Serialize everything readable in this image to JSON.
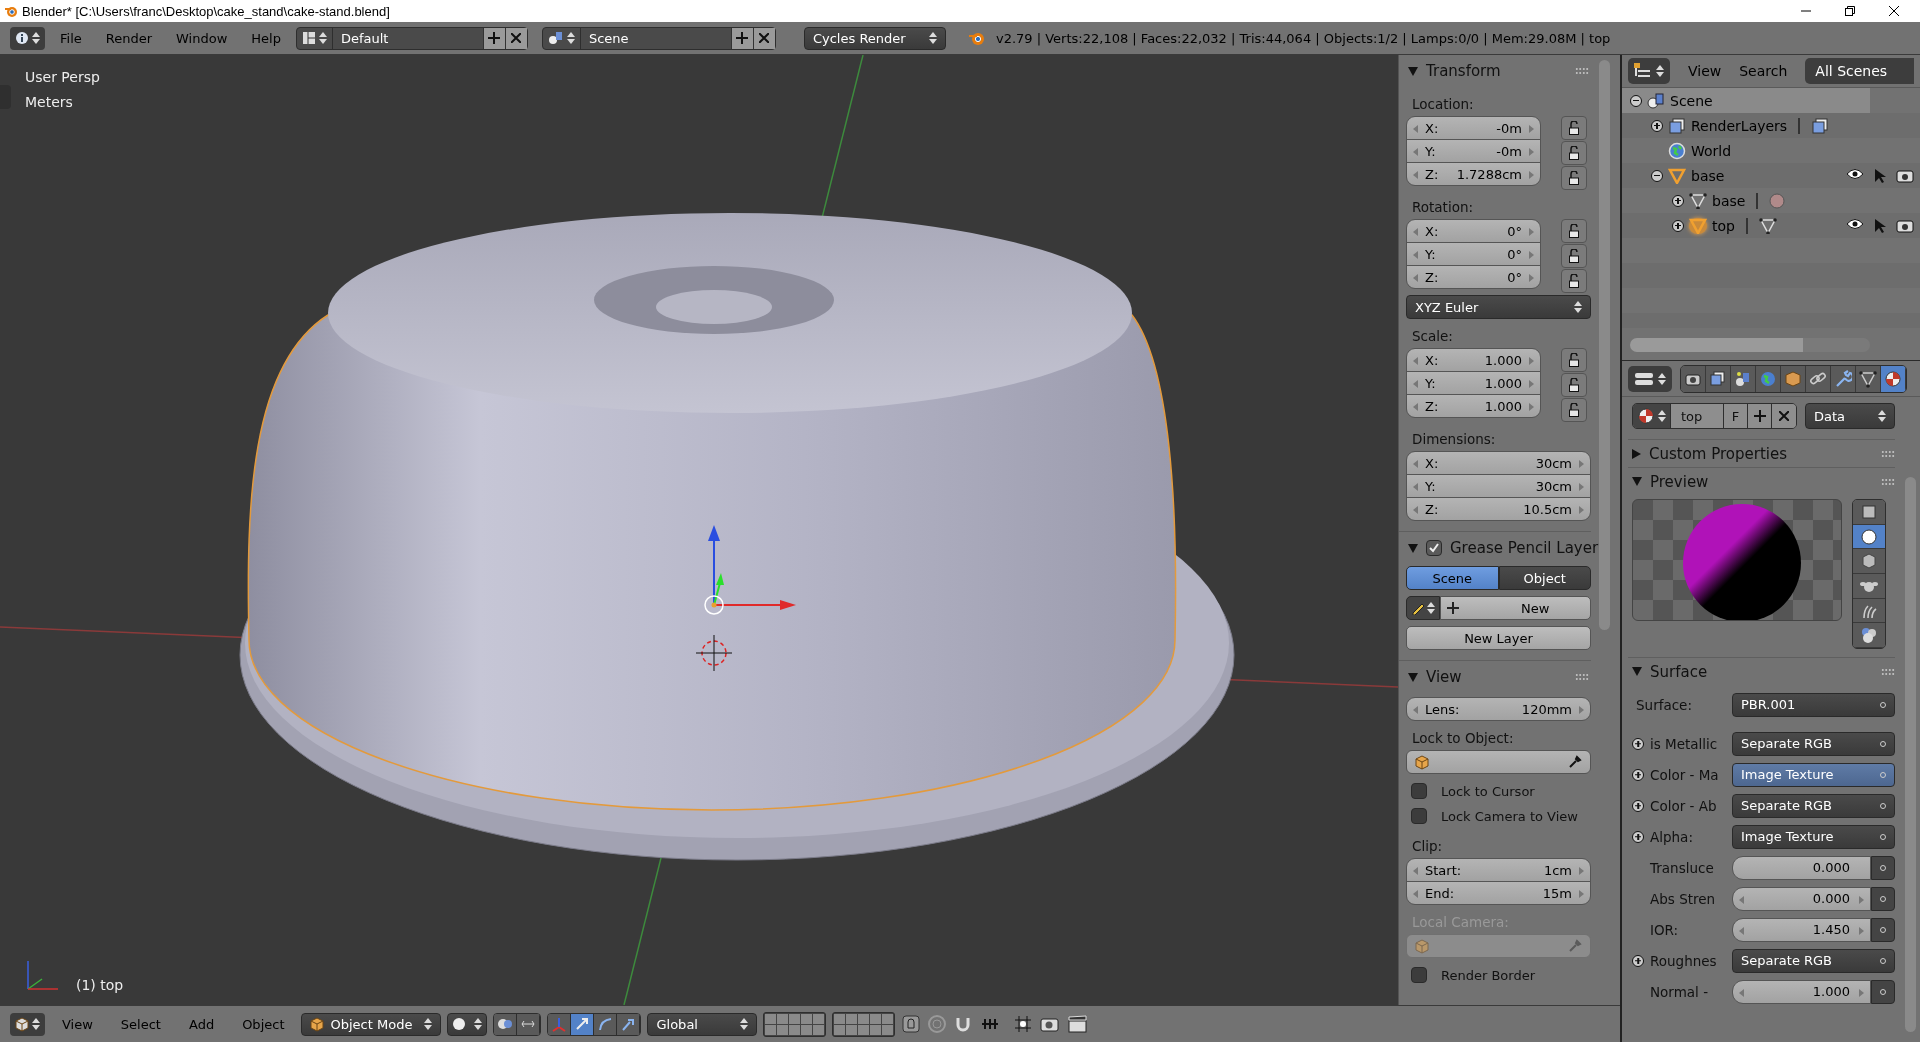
{
  "window": {
    "title": "Blender* [C:\\Users\\franc\\Desktop\\cake_stand\\cake-stand.blend]"
  },
  "info_header": {
    "menus": [
      "File",
      "Render",
      "Window",
      "Help"
    ],
    "layout": "Default",
    "scene": "Scene",
    "engine": "Cycles Render",
    "stats": "v2.79 | Verts:22,108 | Faces:22,032 | Tris:44,064 | Objects:1/2 | Lamps:0/0 | Mem:29.08M | top"
  },
  "viewport": {
    "view_name": "User Persp",
    "units": "Meters",
    "object_label": "(1) top"
  },
  "view_header": {
    "menus": [
      "View",
      "Select",
      "Add",
      "Object"
    ],
    "mode": "Object Mode",
    "orientation": "Global"
  },
  "transform_panel": {
    "title": "Transform",
    "expanded": true,
    "groups": [
      {
        "label": "Location:",
        "fields": [
          {
            "axis": "X:",
            "value": "-0m",
            "locked": false
          },
          {
            "axis": "Y:",
            "value": "-0m",
            "locked": false
          },
          {
            "axis": "Z:",
            "value": "1.7288cm",
            "locked": false
          }
        ]
      },
      {
        "label": "Rotation:",
        "fields": [
          {
            "axis": "X:",
            "value": "0°",
            "locked": false
          },
          {
            "axis": "Y:",
            "value": "0°",
            "locked": false
          },
          {
            "axis": "Z:",
            "value": "0°",
            "locked": false
          }
        ],
        "mode": "XYZ Euler"
      },
      {
        "label": "Scale:",
        "fields": [
          {
            "axis": "X:",
            "value": "1.000",
            "locked": false
          },
          {
            "axis": "Y:",
            "value": "1.000",
            "locked": false
          },
          {
            "axis": "Z:",
            "value": "1.000",
            "locked": false
          }
        ]
      },
      {
        "label": "Dimensions:",
        "fields": [
          {
            "axis": "X:",
            "value": "30cm"
          },
          {
            "axis": "Y:",
            "value": "30cm"
          },
          {
            "axis": "Z:",
            "value": "10.5cm"
          }
        ]
      }
    ]
  },
  "grease_pencil_panel": {
    "title": "Grease Pencil Layer",
    "expanded": true,
    "enabled": true,
    "tabs": [
      {
        "label": "Scene",
        "selected": true
      },
      {
        "label": "Object",
        "selected": false
      }
    ],
    "new_button": "New",
    "new_layer_button": "New Layer"
  },
  "view_panel": {
    "title": "View",
    "expanded": true,
    "lens": {
      "label": "Lens:",
      "value": "120mm"
    },
    "lock_to_object": "Lock to Object:",
    "lock_options": [
      {
        "label": "Lock to Cursor",
        "checked": false
      },
      {
        "label": "Lock Camera to View",
        "checked": false
      }
    ],
    "clip_label": "Clip:",
    "clip": [
      {
        "label": "Start:",
        "value": "1cm"
      },
      {
        "label": "End:",
        "value": "15m"
      }
    ],
    "local_camera": {
      "label": "Local Camera:",
      "disabled": true
    },
    "render_border": {
      "label": "Render Border",
      "checked": false
    }
  },
  "outliner": {
    "menus": [
      "View",
      "Search"
    ],
    "filter": "All Scenes",
    "tree": [
      {
        "name": "Scene",
        "kind": "scene",
        "expanded": true,
        "selected": true,
        "children": [
          {
            "name": "RenderLayers",
            "kind": "renderlayers",
            "expanded": false,
            "selected": false
          },
          {
            "name": "World",
            "kind": "world",
            "selected": false
          },
          {
            "name": "base",
            "kind": "object",
            "expanded": true,
            "selected": false,
            "children": [
              {
                "name": "base",
                "kind": "mesh",
                "expanded": false,
                "selected": false
              },
              {
                "name": "top",
                "kind": "object",
                "expanded": false,
                "selected": true
              }
            ]
          }
        ]
      }
    ]
  },
  "properties": {
    "tabs": [
      {
        "kind": "render",
        "selected": false
      },
      {
        "kind": "renderlayers",
        "selected": false
      },
      {
        "kind": "scene",
        "selected": false
      },
      {
        "kind": "world",
        "selected": false
      },
      {
        "kind": "object",
        "selected": false
      },
      {
        "kind": "constraints",
        "selected": false
      },
      {
        "kind": "modifiers",
        "selected": false
      },
      {
        "kind": "data",
        "selected": false
      },
      {
        "kind": "material",
        "selected": true
      }
    ],
    "material": {
      "name": "top",
      "fake_user": "F",
      "link": "Data"
    },
    "custom_properties": {
      "title": "Custom Properties",
      "expanded": false
    },
    "preview": {
      "title": "Preview",
      "expanded": true,
      "shapes": [
        {
          "kind": "plane",
          "selected": false
        },
        {
          "kind": "sphere",
          "selected": true
        },
        {
          "kind": "cube",
          "selected": false
        },
        {
          "kind": "monkey",
          "selected": false
        },
        {
          "kind": "hair",
          "selected": false
        },
        {
          "kind": "spheres",
          "selected": false
        }
      ]
    },
    "surface": {
      "title": "Surface",
      "expanded": true,
      "label": "Surface:",
      "shader": "PBR.001",
      "inputs": [
        {
          "kind": "link",
          "label": "is Metallic",
          "value": "Separate RGB",
          "selected": false
        },
        {
          "kind": "link",
          "label": "Color - Ma",
          "value": "Image Texture",
          "selected": true
        },
        {
          "kind": "link",
          "label": "Color - Ab",
          "value": "Separate RGB",
          "selected": false
        },
        {
          "kind": "link",
          "label": "Alpha:",
          "value": "Image Texture",
          "selected": false
        },
        {
          "kind": "slider",
          "label": "Transluce",
          "value": "0.000",
          "selected": false
        },
        {
          "kind": "number",
          "label": "Abs Stren",
          "value": "0.000",
          "selected": false
        },
        {
          "kind": "number",
          "label": "IOR:",
          "value": "1.450",
          "selected": false
        },
        {
          "kind": "link",
          "label": "Roughnes",
          "value": "Separate RGB",
          "selected": false
        },
        {
          "kind": "number",
          "label": "Normal -",
          "value": "1.000",
          "selected": false
        }
      ]
    }
  }
}
